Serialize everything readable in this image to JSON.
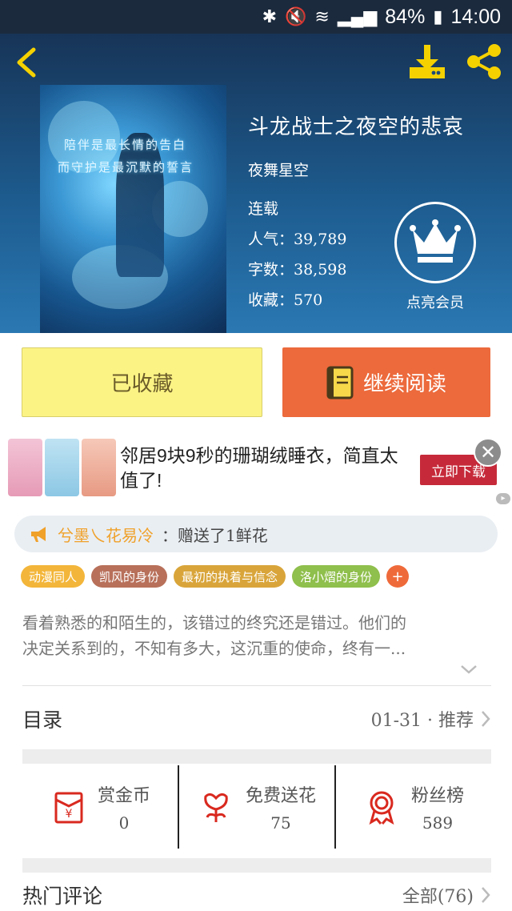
{
  "status_bar": {
    "battery": "84%",
    "time": "14:00"
  },
  "book": {
    "title": "斗龙战士之夜空的悲哀",
    "author": "夜舞星空",
    "status": "连载",
    "popularity": "人气：39,789",
    "word_count": "字数：38,598",
    "favorites": "收藏：570",
    "cover_caption_1": "陪伴是最长情的告白",
    "cover_caption_2": "而守护是最沉默的誓言"
  },
  "vip": {
    "label": "点亮会员"
  },
  "actions": {
    "favorited_label": "已收藏",
    "continue_label": "继续阅读"
  },
  "ad": {
    "text": "邻居9块9秒的珊瑚绒睡衣，简直太值了!",
    "button_label": "立即下载"
  },
  "gift": {
    "sender": "兮墨乀花易冷",
    "message": "：赠送了1鲜花"
  },
  "tags": [
    {
      "label": "动漫同人",
      "color": "#f3b63a"
    },
    {
      "label": "凯风的身份",
      "color": "#b8705a"
    },
    {
      "label": "最初的执着与信念",
      "color": "#d9a53a"
    },
    {
      "label": "洛小熠的身份",
      "color": "#8fbf4c"
    }
  ],
  "description": {
    "line1": "看着熟悉的和陌生的，该错过的终究还是错过。他们的",
    "line2": "决定关系到的，不知有多大，这沉重的使命，终有一..."
  },
  "toc": {
    "label": "目录",
    "info": "01-31 · 推荐"
  },
  "stats": [
    {
      "label": "赏金币",
      "value": "0"
    },
    {
      "label": "免费送花",
      "value": "75"
    },
    {
      "label": "粉丝榜",
      "value": "589"
    }
  ],
  "comments": {
    "label": "热门评论",
    "all": "全部(76)"
  },
  "colors": {
    "accent_orange": "#ec6a3c",
    "fav_yellow": "#fbf384",
    "icon_yellow": "#f5d100",
    "stat_red": "#d9291f"
  }
}
